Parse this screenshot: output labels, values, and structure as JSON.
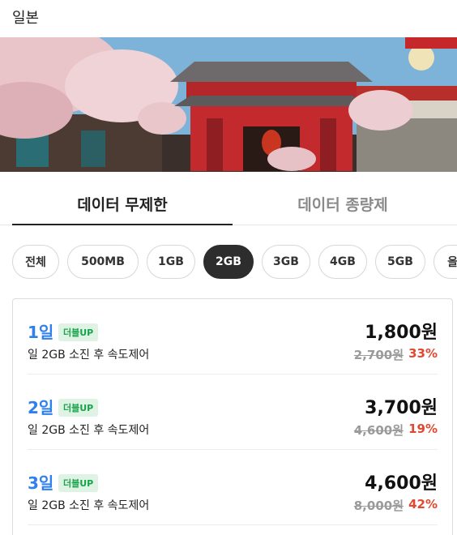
{
  "header": {
    "title": "일본"
  },
  "hero": {
    "image": "japan-temple-cherry-blossom"
  },
  "tabs": [
    {
      "label": "데이터 무제한",
      "active": true
    },
    {
      "label": "데이터 종량제",
      "active": false
    }
  ],
  "chips": [
    {
      "label": "전체",
      "active": false
    },
    {
      "label": "500MB",
      "active": false
    },
    {
      "label": "1GB",
      "active": false
    },
    {
      "label": "2GB",
      "active": true
    },
    {
      "label": "3GB",
      "active": false
    },
    {
      "label": "4GB",
      "active": false
    },
    {
      "label": "5GB",
      "active": false
    },
    {
      "label": "올데",
      "active": false
    }
  ],
  "plans": [
    {
      "days": "1일",
      "badge": "더블UP",
      "desc": "일 2GB 소진 후 속도제어",
      "price": "1,800원",
      "original": "2,700원",
      "discount": "33%"
    },
    {
      "days": "2일",
      "badge": "더블UP",
      "desc": "일 2GB 소진 후 속도제어",
      "price": "3,700원",
      "original": "4,600원",
      "discount": "19%"
    },
    {
      "days": "3일",
      "badge": "더블UP",
      "desc": "일 2GB 소진 후 속도제어",
      "price": "4,600원",
      "original": "8,000원",
      "discount": "42%"
    }
  ],
  "colors": {
    "accent_blue": "#2f80ed",
    "discount_red": "#e2472f",
    "badge_green": "#16a34a",
    "badge_bg": "#dff3e4",
    "chip_active": "#2d2d2d"
  }
}
